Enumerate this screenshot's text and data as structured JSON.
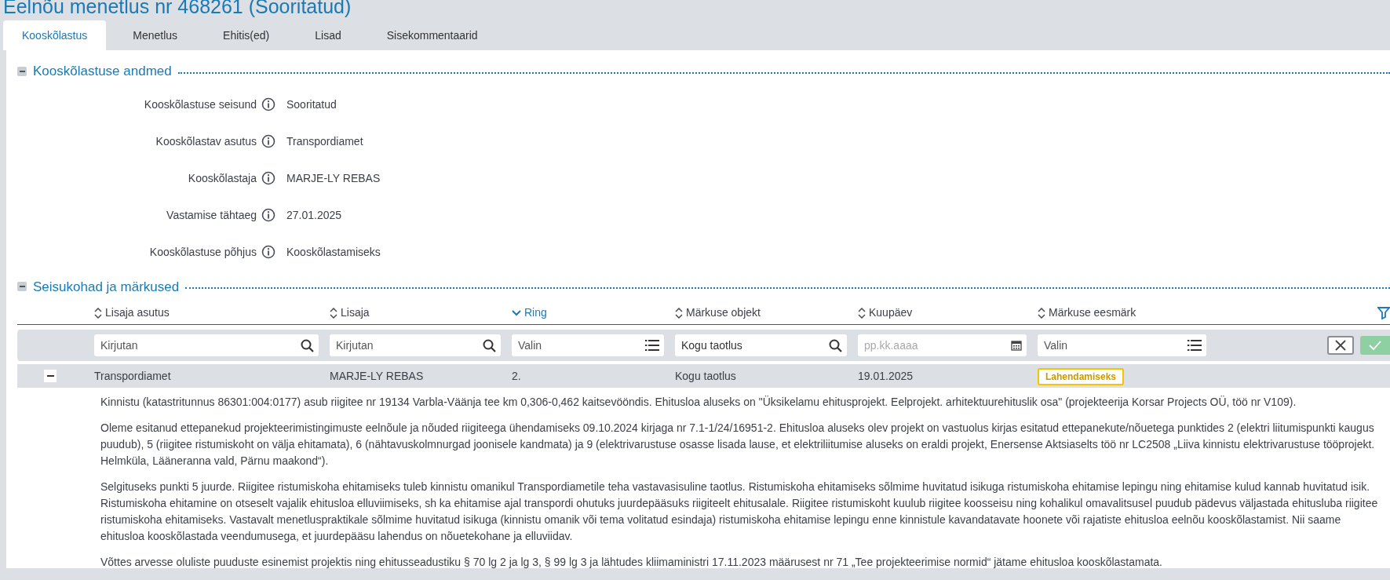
{
  "page_title": "Eelnõu menetlus nr 468261 (Sooritatud)",
  "tabs": [
    {
      "label": "Kooskõlastus",
      "selected": true
    },
    {
      "label": "Menetlus",
      "selected": false
    },
    {
      "label": "Ehitis(ed)",
      "selected": false
    },
    {
      "label": "Lisad",
      "selected": false
    },
    {
      "label": "Sisekommentaarid",
      "selected": false
    }
  ],
  "details_section": {
    "title": "Kooskõlastuse andmed",
    "expanded": true,
    "fields": [
      {
        "label": "Kooskõlastuse seisund",
        "value": "Sooritatud"
      },
      {
        "label": "Kooskõlastav asutus",
        "value": "Transpordiamet"
      },
      {
        "label": "Kooskõlastaja",
        "value": "MARJE-LY REBAS"
      },
      {
        "label": "Vastamise tähtaeg",
        "value": "27.01.2025"
      },
      {
        "label": "Kooskõlastuse põhjus",
        "value": "Kooskõlastamiseks"
      }
    ]
  },
  "remarks_section": {
    "title": "Seisukohad ja märkused",
    "expanded": true,
    "columns": [
      {
        "label": "Lisaja asutus",
        "sorted": false
      },
      {
        "label": "Lisaja",
        "sorted": false
      },
      {
        "label": "Ring",
        "sorted": true
      },
      {
        "label": "Märkuse objekt",
        "sorted": false
      },
      {
        "label": "Kuupäev",
        "sorted": false
      },
      {
        "label": "Märkuse eesmärk",
        "sorted": false
      }
    ],
    "filters": [
      {
        "kind": "text",
        "placeholder": "Kirjutan"
      },
      {
        "kind": "text",
        "placeholder": "Kirjutan"
      },
      {
        "kind": "select",
        "placeholder": "Valin"
      },
      {
        "kind": "text",
        "value": "Kogu taotlus"
      },
      {
        "kind": "date",
        "placeholder": "pp.kk.aaaa"
      },
      {
        "kind": "select",
        "placeholder": "Valin"
      }
    ],
    "rows": [
      {
        "expanded": true,
        "cells": [
          "Transpordiamet",
          "MARJE-LY REBAS",
          "2.",
          "Kogu taotlus",
          "19.01.2025"
        ],
        "purpose": "Lahendamiseks",
        "paragraphs": [
          "Kinnistu (katastritunnus 86301:004:0177) asub riigitee nr 19134 Varbla-Väänja tee km 0,306-0,462 kaitsevööndis. Ehitusloa aluseks on \"Üksikelamu ehitusprojekt. Eelprojekt. arhitektuurehituslik osa\" (projekteerija Korsar Projects OÜ, töö nr V109).",
          "Oleme esitanud ettepanekud projekteerimistingimuste eelnõule ja nõuded riigiteega ühendamiseks 09.10.2024 kirjaga nr 7.1-1/24/16951-2. Ehitusloa aluseks olev projekt on vastuolus kirjas esitatud ettepanekute/nõuetega punktides 2 (elektri liitumispunkti kaugus puudub), 5 (riigitee ristumiskoht on välja ehitamata), 6 (nähtavuskolmnurgad joonisele kandmata) ja 9 (elektrivarustuse osasse lisada lause, et elektriliitumise aluseks on eraldi projekt, Enersense Aktsiaselts töö nr LC2508 „Liiva kinnistu elektrivarustuse tööprojekt. Helmküla, Lääneranna vald, Pärnu maakond“).",
          "Selgituseks punkti 5 juurde. Riigitee ristumiskoha ehitamiseks tuleb kinnistu omanikul Transpordiametile teha vastavasisuline taotlus. Ristumiskoha ehitamiseks sõlmime huvitatud isikuga ristumiskoha ehitamise lepingu ning ehitamise kulud kannab huvitatud isik. Ristumiskoha ehitamine on otseselt vajalik ehitusloa elluviimiseks, sh ka ehitamise ajal transpordi ohutuks juurdepääsuks riigiteelt ehitusalale. Riigitee ristumiskoht kuulub riigitee koosseisu ning kohalikul omavalitsusel puudub pädevus väljastada ehitusluba riigitee ristumiskoha ehitamiseks. Vastavalt menetluspraktikale sõlmime huvitatud isikuga (kinnistu omanik või tema volitatud esindaja) ristumiskoha ehitamise lepingu enne kinnistule kavandatavate hoonete või rajatiste ehitusloa eelnõu kooskõlastamist. Nii saame ehitusloa kooskõlastada veendumusega, et juurdepääsu lahendus on nõuetekohane ja elluviidav.",
          "Võttes arvesse oluliste puuduste esinemist projektis ning ehitusseadustiku § 70 lg 2 ja lg 3, § 99 lg 3 ja lähtudes kliimaministri 17.11.2023 määrusest nr 71 „Tee projekteerimise normid“ jätame ehitusloa kooskõlastamata."
        ]
      }
    ]
  }
}
